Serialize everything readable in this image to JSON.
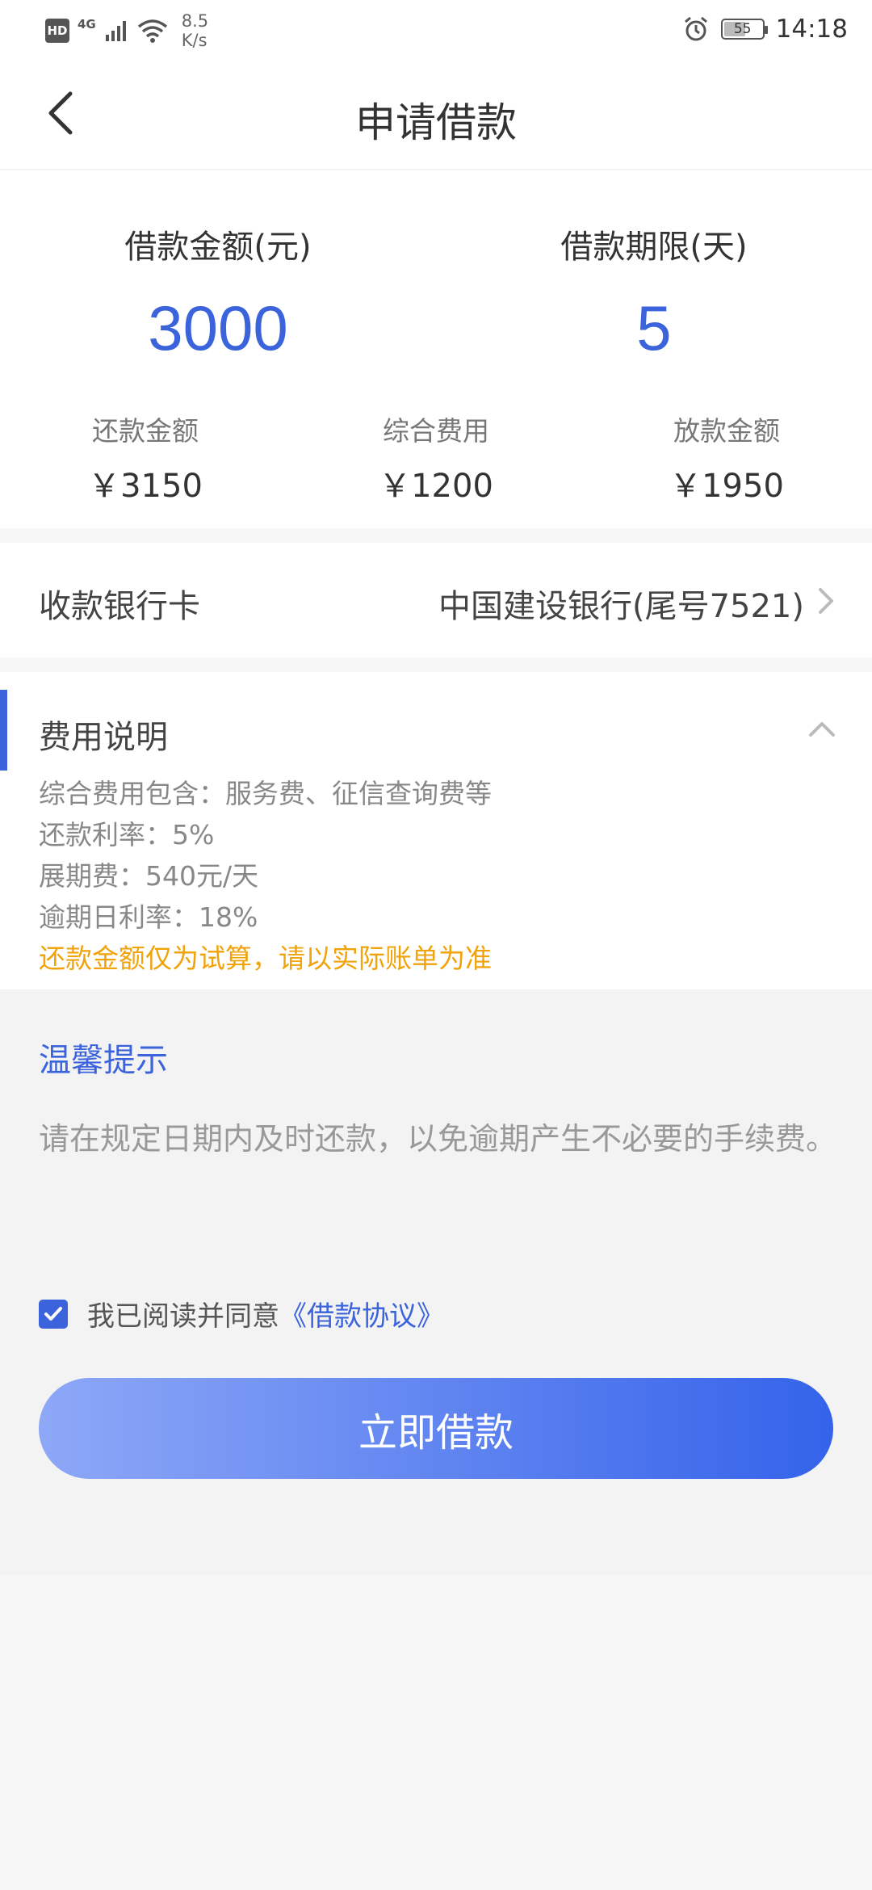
{
  "status_bar": {
    "hd": "HD",
    "network": "4G",
    "speed_value": "8.5",
    "speed_unit": "K/s",
    "battery": "55",
    "time": "14:18"
  },
  "nav": {
    "title": "申请借款"
  },
  "summary": {
    "amount_label": "借款金额(元)",
    "amount_value": "3000",
    "term_label": "借款期限(天)",
    "term_value": "5",
    "repay_label": "还款金额",
    "repay_value": "￥3150",
    "fee_label": "综合费用",
    "fee_value": "￥1200",
    "disburse_label": "放款金额",
    "disburse_value": "￥1950"
  },
  "bank": {
    "label": "收款银行卡",
    "value": "中国建设银行(尾号7521)"
  },
  "fee_section": {
    "title": "费用说明",
    "lines": [
      "综合费用包含：服务费、征信查询费等",
      "还款利率：5%",
      "展期费：540元/天",
      "逾期日利率：18%"
    ],
    "note": "还款金额仅为试算，请以实际账单为准"
  },
  "tips": {
    "title": "温馨提示",
    "text": "请在规定日期内及时还款，以免逾期产生不必要的手续费。"
  },
  "agreement": {
    "checked": true,
    "text": "我已阅读并同意",
    "link": "《借款协议》"
  },
  "submit": {
    "label": "立即借款"
  },
  "colors": {
    "accent": "#3a63dc",
    "warning": "#f0a30a"
  }
}
